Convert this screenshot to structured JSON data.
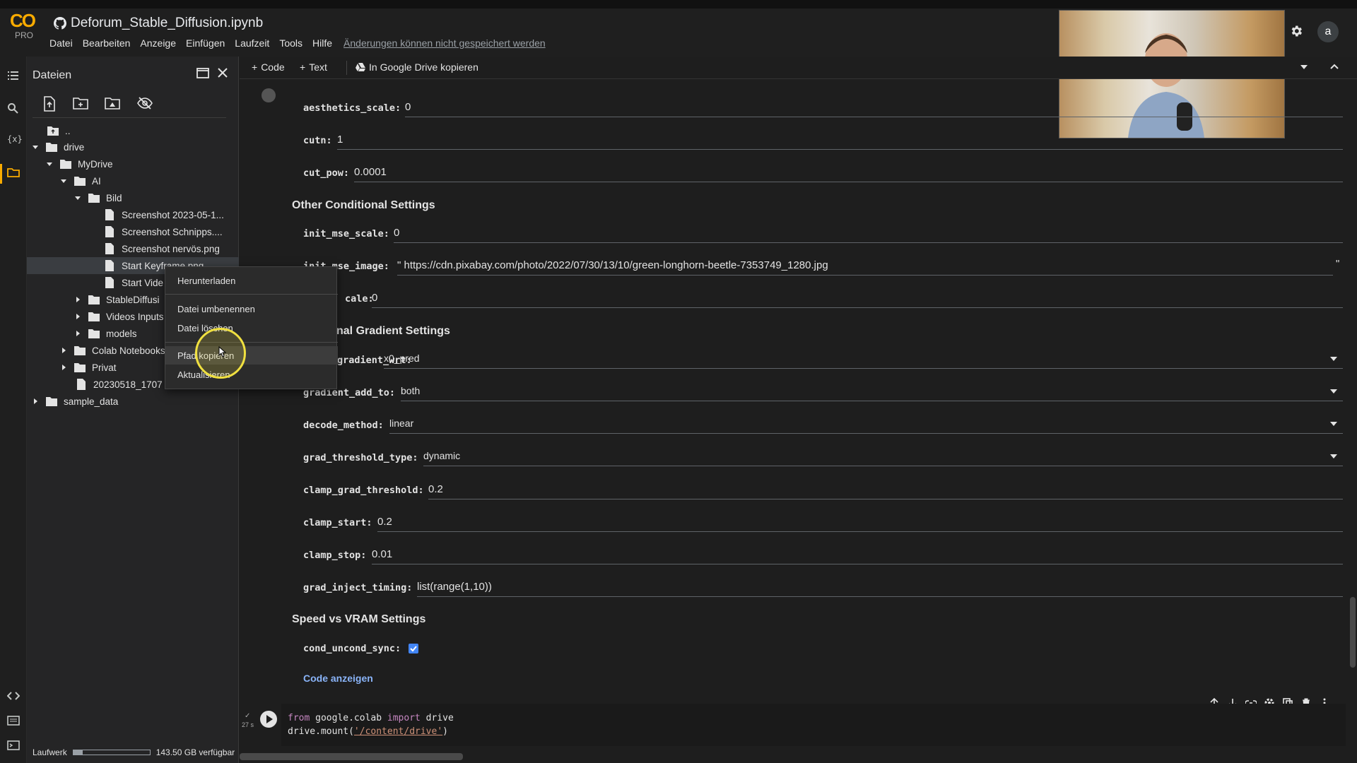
{
  "app": {
    "title": "Deforum_Stable_Diffusion.ipynb",
    "logo_text": "CO",
    "logo_sub": "PRO",
    "avatar_letter": "a"
  },
  "menu": [
    "Datei",
    "Bearbeiten",
    "Anzeige",
    "Einfügen",
    "Laufzeit",
    "Tools",
    "Hilfe"
  ],
  "menu_warning": "Änderungen können nicht gespeichert werden",
  "toolbar": {
    "code": "Code",
    "text": "Text",
    "copy_drive": "In Google Drive kopieren"
  },
  "sidebar": {
    "title": "Dateien",
    "tree": [
      {
        "label": ".."
      },
      {
        "label": "drive"
      },
      {
        "label": "MyDrive"
      },
      {
        "label": "AI"
      },
      {
        "label": "Bild"
      },
      {
        "label": "Screenshot 2023-05-1..."
      },
      {
        "label": "Screenshot Schnipps...."
      },
      {
        "label": "Screenshot nervös.png"
      },
      {
        "label": "Start Keyframe.png"
      },
      {
        "label": "Start Vide"
      },
      {
        "label": "StableDiffusi"
      },
      {
        "label": "Videos Inputs"
      },
      {
        "label": "models"
      },
      {
        "label": "Colab Notebooks"
      },
      {
        "label": "Privat"
      },
      {
        "label": "20230518_1707"
      },
      {
        "label": "sample_data"
      }
    ],
    "drive_label": "Laufwerk",
    "drive_free": "143.50 GB verfügbar",
    "drive_usage_fraction": 0.12
  },
  "context_menu": {
    "items": [
      "Herunterladen",
      "Datei umbenennen",
      "Datei löschen",
      "Pfad kopieren",
      "Aktualisieren"
    ]
  },
  "form": {
    "fields": [
      {
        "label": "aesthetics_scale:",
        "value": "0"
      },
      {
        "label": "cutn:",
        "value": "1"
      },
      {
        "label": "cut_pow:",
        "value": "0.0001"
      },
      {
        "label": "init_mse_scale:",
        "value": "0"
      },
      {
        "label": "init_mse_image:",
        "value": "\" https://cdn.pixabay.com/photo/2022/07/30/13/10/green-longhorn-beetle-7353749_1280.jpg"
      },
      {
        "label": "",
        "value": "0"
      },
      {
        "label": "gradient_wrt:",
        "value": "x0_pred"
      },
      {
        "label": "gradient_add_to:",
        "value": "both"
      },
      {
        "label": "decode_method:",
        "value": "linear"
      },
      {
        "label": "grad_threshold_type:",
        "value": "dynamic"
      },
      {
        "label": "clamp_grad_threshold:",
        "value": "0.2"
      },
      {
        "label": "clamp_start:",
        "value": "0.2"
      },
      {
        "label": "clamp_stop:",
        "value": "0.01"
      },
      {
        "label": "grad_inject_timing:",
        "value": "list(range(1,10))"
      },
      {
        "label": "cond_uncond_sync:",
        "value": ""
      }
    ],
    "init_mse_image_trailing_quote": "\"",
    "scale_label_fragment": "cale:",
    "sections": [
      "Other Conditional Settings",
      "nal Gradient Settings",
      "Speed vs VRAM Settings"
    ],
    "show_code": "Code anzeigen",
    "cond_uncond_sync_checked": true
  },
  "code_cell": {
    "status_check": "✓",
    "elapsed": "27 s",
    "line1_kw1": "from",
    "line1_mod": " google.colab ",
    "line1_kw2": "import",
    "line1_name": " drive",
    "line2_pre": "drive.mount(",
    "line2_str": "'/content/drive'",
    "line2_post": ")"
  }
}
